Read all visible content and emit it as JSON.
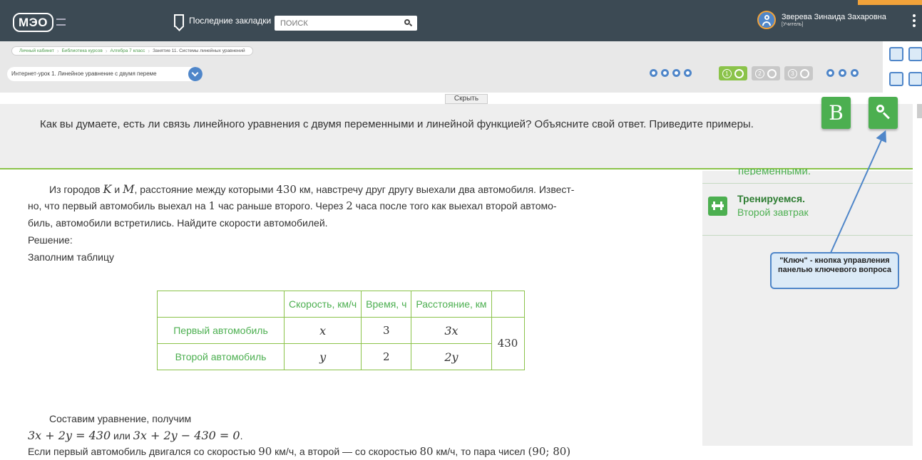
{
  "header": {
    "logo_text": "МЭО",
    "bookmarks_label": "Последние закладки",
    "search_placeholder": "ПОИСК",
    "user_name": "Зверева Зинаида Захаровна",
    "user_role": "[Учитель]"
  },
  "breadcrumb": [
    "Личный кабинет",
    "Библиотека курсов",
    "Алгебра 7 класс",
    "Занятие 11. Системы линейных уравнений"
  ],
  "lesson_select": "Интернет-урок 1. Линейное уравнение с двумя переме",
  "steps": [
    {
      "num": "1",
      "active": true
    },
    {
      "num": "2",
      "active": false
    },
    {
      "num": "3",
      "active": false
    }
  ],
  "hide_label": "Скрыть",
  "question": "Как вы думаете, есть ли связь линейного уравнения с двумя переменными и линейной функцией? Объясните свой ответ. Приведите примеры.",
  "key_buttons": {
    "b_label": "В"
  },
  "problem": {
    "p1_a": "Из городов ",
    "p1_K": "K",
    "p1_and": " и ",
    "p1_M": "M",
    "p1_b": ", расстояние между которыми ",
    "p1_430": "430",
    "p1_c": " км, навстречу друг другу выехали два автомобиля. Извест-",
    "p2_a": "но, что первый автомобиль выехал на ",
    "p2_1": "1",
    "p2_b": " час раньше второго. Через ",
    "p2_2": "2",
    "p2_c": " часа после того как выехал второй автомо-",
    "p3": "биль, автомобили встретились. Найдите скорости автомобилей.",
    "solution": "Решение:",
    "fill_table": "Заполним таблицу"
  },
  "table": {
    "headers": [
      "",
      "Скорость, км/ч",
      "Время, ч",
      "Расстояние, км",
      ""
    ],
    "rows": [
      {
        "label": "Первый автомобиль",
        "speed": "x",
        "time": "3",
        "distance": "3x"
      },
      {
        "label": "Второй автомобиль",
        "speed": "y",
        "time": "2",
        "distance": "2y"
      }
    ],
    "total": "430"
  },
  "after": {
    "compose": "Составим уравнение, получим",
    "eq1": "3x + 2y = 430",
    "or": " или ",
    "eq2": "3x + 2y − 430 = 0",
    "dot": ".",
    "last_a": "Если первый автомобиль двигался со скоростью ",
    "last_90": "90",
    "last_b": " км/ч, а второй — со скоростью ",
    "last_80": "80",
    "last_c": " км/ч, то пара чисел ",
    "last_pair": "(90; 80)"
  },
  "right_panel": {
    "partial": "переменными.",
    "item_title": "Тренируемся.",
    "item_sub": "Второй завтрак"
  },
  "callout": "\"Ключ\" - кнопка управления панелью ключевого вопроса",
  "colors": {
    "topbar": "#3c4a54",
    "green": "#4caf50",
    "blue": "#4f86c9",
    "orange": "#f1a23a"
  }
}
